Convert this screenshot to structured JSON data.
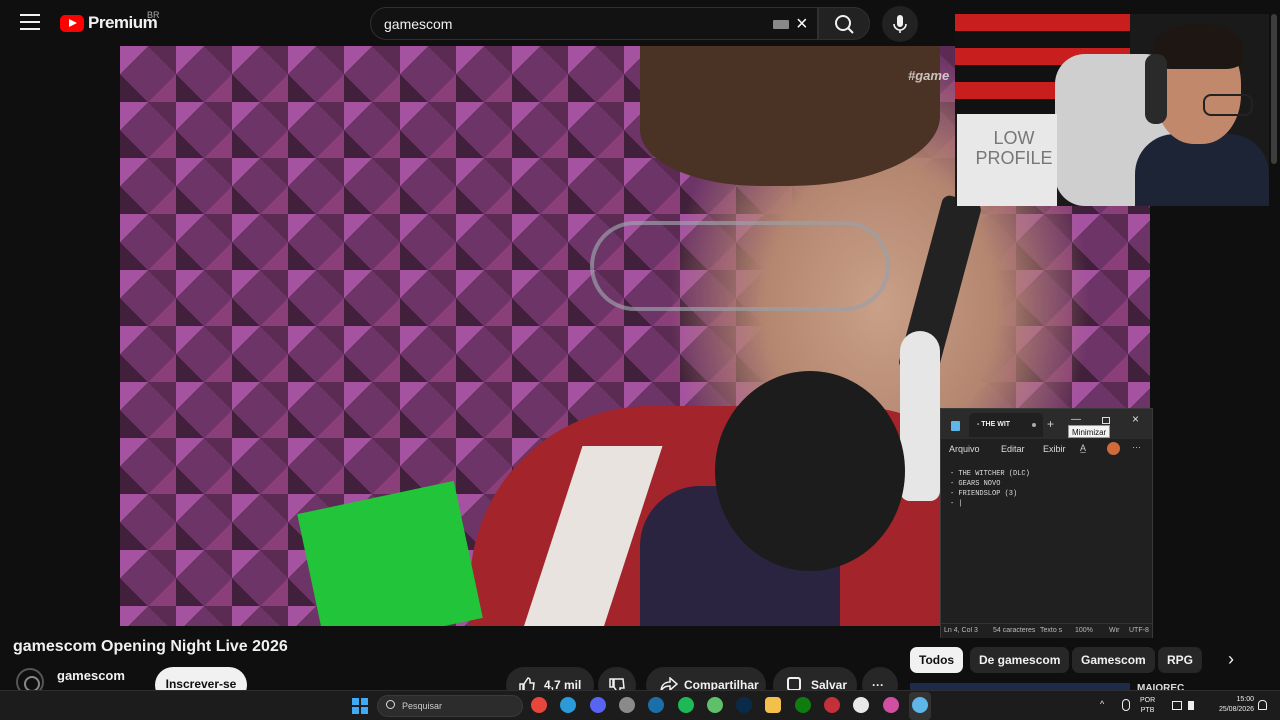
{
  "header": {
    "logo_text": "Premium",
    "country_code": "BR",
    "search_value": "gamescom"
  },
  "video": {
    "overlay_hashtag": "#game",
    "title": "gamescom Opening Night Live 2026"
  },
  "webcam": {
    "poster_text": "LOW PROFILE"
  },
  "notepad": {
    "tab_title": "- THE WIT",
    "tooltip": "Minimizar",
    "menu": [
      "Arquivo",
      "Editar",
      "Exibir"
    ],
    "lines": [
      "- THE WITCHER (DLC)",
      "- GEARS NOVO",
      "- FRIENDSLOP (3)",
      "- |"
    ],
    "status": {
      "position": "Ln 4, Col 3",
      "chars": "54 caracteres",
      "format": "Texto s",
      "zoom": "100%",
      "line_ending": "Wir",
      "encoding": "UTF-8"
    }
  },
  "channel": {
    "name": "gamescom",
    "subscribe_label": "Inscrever-se"
  },
  "actions": {
    "likes": "4,7 mil",
    "share_label": "Compartilhar",
    "save_label": "Salvar",
    "more_label": "···"
  },
  "chips": [
    "Todos",
    "De gamescom",
    "Gamescom",
    "RPG"
  ],
  "sidebar_preview_text": "MAIOREC",
  "taskbar": {
    "search_placeholder": "Pesquisar",
    "language": "POR",
    "keyboard": "PTB",
    "time": "15:00",
    "date": "25/08/2026",
    "apps": [
      {
        "name": "chrome-icon",
        "color": "#e8453c"
      },
      {
        "name": "edge-icon",
        "color": "#2b9ad9"
      },
      {
        "name": "discord-icon",
        "color": "#5865f2"
      },
      {
        "name": "obs-icon",
        "color": "#8a8a8a"
      },
      {
        "name": "steam-icon",
        "color": "#1b6fa8"
      },
      {
        "name": "spotify-icon",
        "color": "#1db954"
      },
      {
        "name": "phone-link-icon",
        "color": "#5fbf6a"
      },
      {
        "name": "photoshop-icon",
        "color": "#0a2a4a"
      },
      {
        "name": "file-explorer-icon",
        "color": "#f2c04b"
      },
      {
        "name": "xbox-icon",
        "color": "#107c10"
      },
      {
        "name": "valorant-icon",
        "color": "#c3303a"
      },
      {
        "name": "circle-app-icon",
        "color": "#e8e8e8"
      },
      {
        "name": "pen-app-icon",
        "color": "#d04fa0"
      },
      {
        "name": "notepad-icon",
        "color": "#5fb6e8"
      }
    ]
  }
}
